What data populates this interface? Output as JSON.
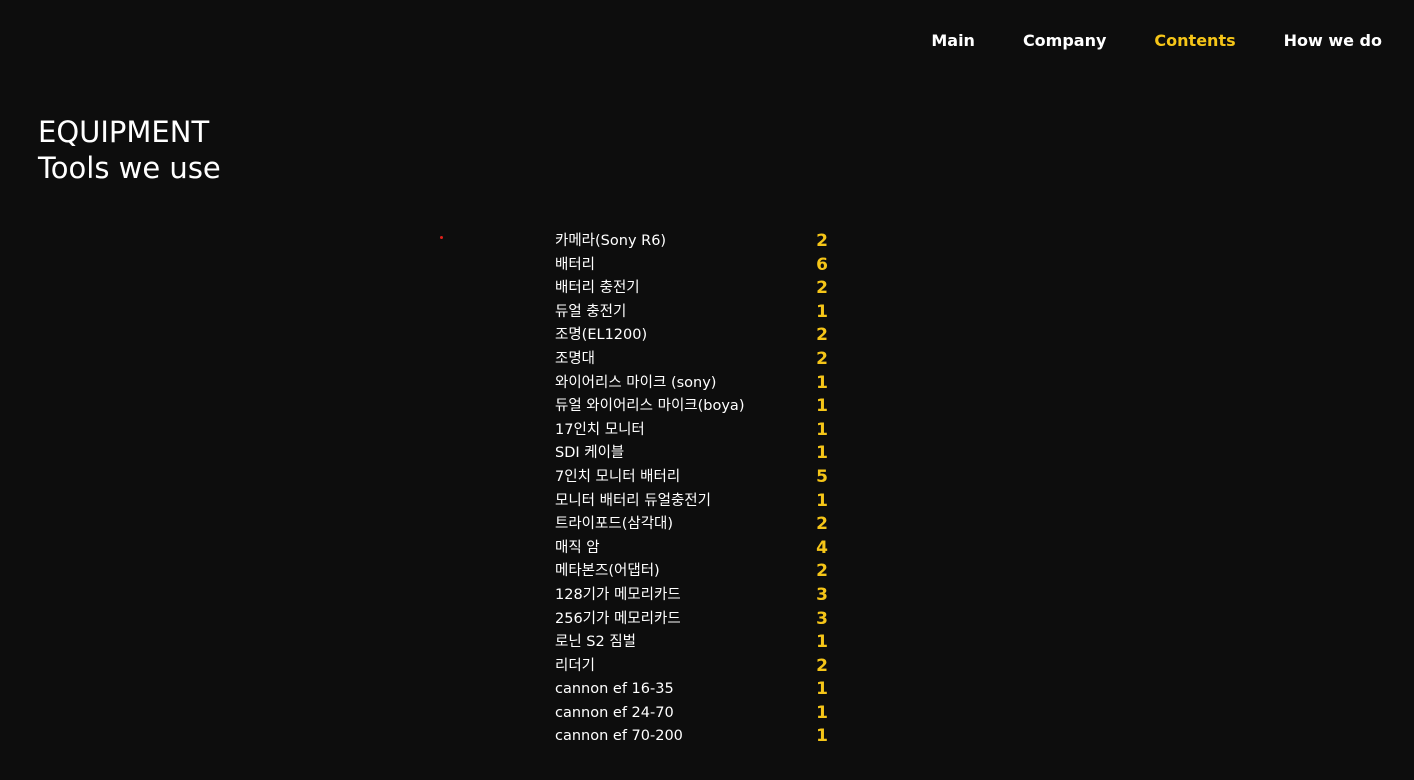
{
  "nav": {
    "items": [
      {
        "label": "Main",
        "active": false
      },
      {
        "label": "Company",
        "active": false
      },
      {
        "label": "Contents",
        "active": true
      },
      {
        "label": "How we do",
        "active": false
      }
    ],
    "active_color": "#f5c518"
  },
  "heading": {
    "eyebrow": "EQUIPMENT",
    "title": "Tools we use"
  },
  "equipment": [
    {
      "name": "카메라(Sony R6)",
      "qty": "2"
    },
    {
      "name": "배터리",
      "qty": "6"
    },
    {
      "name": "배터리 충전기",
      "qty": "2"
    },
    {
      "name": "듀얼 충전기",
      "qty": "1"
    },
    {
      "name": "조명(EL1200)",
      "qty": "2"
    },
    {
      "name": "조명대",
      "qty": "2"
    },
    {
      "name": "와이어리스 마이크 (sony)",
      "qty": "1"
    },
    {
      "name": "듀얼 와이어리스 마이크(boya)",
      "qty": "1"
    },
    {
      "name": "17인치 모니터",
      "qty": "1"
    },
    {
      "name": "SDI 케이블",
      "qty": "1"
    },
    {
      "name": "7인치 모니터 배터리",
      "qty": "5"
    },
    {
      "name": "모니터 배터리 듀얼충전기",
      "qty": "1"
    },
    {
      "name": "트라이포드(삼각대)",
      "qty": "2"
    },
    {
      "name": "매직 암",
      "qty": "4"
    },
    {
      "name": "메타본즈(어댑터)",
      "qty": "2"
    },
    {
      "name": "128기가 메모리카드",
      "qty": "3"
    },
    {
      "name": "256기가 메모리카드",
      "qty": "3"
    },
    {
      "name": "로닌 S2 짐벌",
      "qty": "1"
    },
    {
      "name": "리더기",
      "qty": "2"
    },
    {
      "name": "cannon ef 16-35",
      "qty": "1"
    },
    {
      "name": "cannon ef 24-70",
      "qty": "1"
    },
    {
      "name": "cannon ef 70-200",
      "qty": "1"
    }
  ],
  "colors": {
    "background": "#0d0d0d",
    "text": "#ffffff",
    "accent": "#f5c518"
  }
}
